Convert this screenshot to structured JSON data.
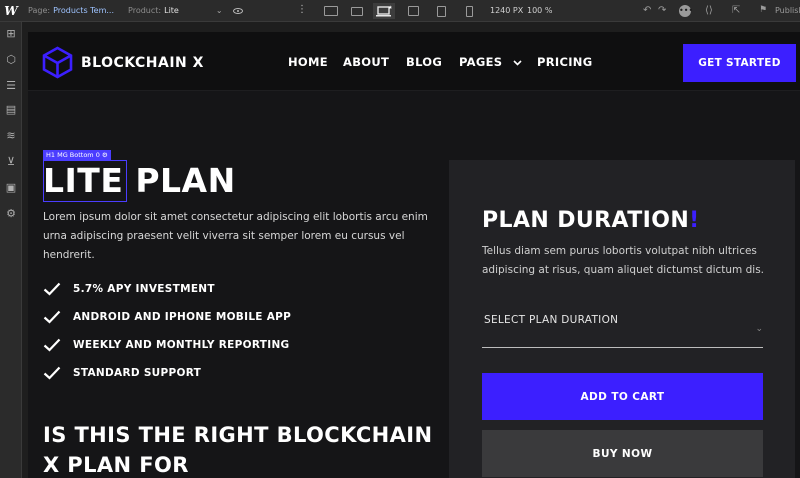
{
  "editor": {
    "logo": "W",
    "page_label": "Page:",
    "page_value": "Products Tem...",
    "product_label": "Product:",
    "product_value": "Lite",
    "canvas_width": "1240 PX",
    "zoom": "100 %",
    "publish_label": "Publish"
  },
  "site": {
    "brand": "BLOCKCHAIN X",
    "nav": {
      "home": "HOME",
      "about": "ABOUT",
      "blog": "BLOG",
      "pages": "PAGES",
      "pricing": "PRICING"
    },
    "cta": "GET STARTED"
  },
  "selection": {
    "tag": "H1  MG Bottom 0  ⚙"
  },
  "hero": {
    "title": "LITE PLAN",
    "lead": "Lorem ipsum dolor sit amet consectetur adipiscing elit lobortis arcu enim urna adipiscing praesent velit viverra sit semper lorem eu cursus vel hendrerit.",
    "features": [
      "5.7% APY INVESTMENT",
      "ANDROID AND IPHONE MOBILE APP",
      "WEEKLY AND MONTHLY REPORTING",
      "STANDARD SUPPORT"
    ],
    "subheading": "IS THIS THE RIGHT BLOCKCHAIN X PLAN FOR"
  },
  "plan_card": {
    "title": "PLAN DURATION",
    "title_accent": "!",
    "description": "Tellus diam sem purus lobortis volutpat nibh ultrices adipiscing at risus, quam aliquet dictumst dictum dis.",
    "select_placeholder": "SELECT PLAN DURATION",
    "add_to_cart": "ADD TO CART",
    "buy_now": "BUY NOW"
  },
  "colors": {
    "accent": "#3c1fff",
    "page_bg": "#151517",
    "card_bg": "#222225"
  }
}
